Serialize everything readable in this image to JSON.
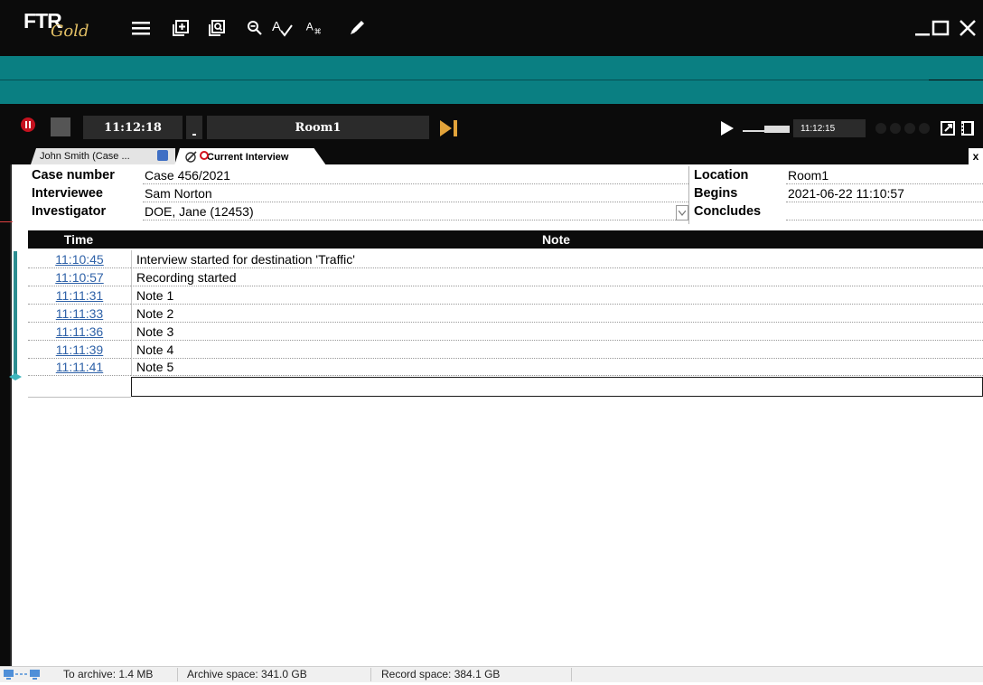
{
  "app": {
    "logo_main": "FTR",
    "logo_sub": "Gold"
  },
  "toolbar": {
    "icons": [
      "menu-icon",
      "add-note-icon",
      "search-note-icon",
      "zoom-icon",
      "spellcheck-icon",
      "text-format-icon",
      "pencil-icon"
    ]
  },
  "window_controls": [
    "minimize-icon",
    "maximize-icon",
    "close-icon"
  ],
  "transport": {
    "record_time": "11:12:18",
    "room": "Room1",
    "playback_time": "11:12:15"
  },
  "tabs": [
    {
      "label": "John Smith (Case ..."
    },
    {
      "label": "Current Interview"
    }
  ],
  "tab_close": "x",
  "info": {
    "case_number_label": "Case number",
    "case_number": "Case 456/2021",
    "interviewee_label": "Interviewee",
    "interviewee": "Sam Norton",
    "investigator_label": "Investigator",
    "investigator": "DOE, Jane (12453)",
    "location_label": "Location",
    "location": "Room1",
    "begins_label": "Begins",
    "begins": "2021-06-22 11:10:57",
    "concludes_label": "Concludes",
    "concludes": ""
  },
  "notes": {
    "columns": [
      "Time",
      "Note"
    ],
    "rows": [
      {
        "time": "11:10:45",
        "note": "Interview started for destination 'Traffic'"
      },
      {
        "time": "11:10:57",
        "note": "Recording started"
      },
      {
        "time": "11:11:31",
        "note": "Note 1"
      },
      {
        "time": "11:11:33",
        "note": "Note 2"
      },
      {
        "time": "11:11:36",
        "note": "Note 3"
      },
      {
        "time": "11:11:39",
        "note": "Note 4"
      },
      {
        "time": "11:11:41",
        "note": "Note 5"
      }
    ]
  },
  "status": {
    "to_archive": "To archive: 1.4 MB",
    "archive_space": "Archive space: 341.0 GB",
    "record_space": "Record space: 384.1 GB"
  },
  "colors": {
    "teal": "#0a7f82",
    "record_red": "#c5121f",
    "link_blue": "#2f62a8",
    "gold": "#e3c065"
  }
}
